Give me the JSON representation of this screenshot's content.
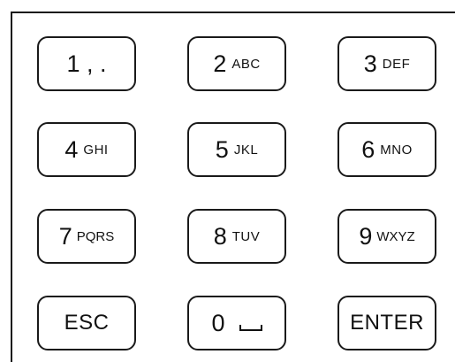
{
  "keypad": {
    "keys": [
      {
        "digit": "1 , .",
        "letters": ""
      },
      {
        "digit": "2",
        "letters": "ABC"
      },
      {
        "digit": "3",
        "letters": "DEF"
      },
      {
        "digit": "4",
        "letters": "GHI"
      },
      {
        "digit": "5",
        "letters": "JKL"
      },
      {
        "digit": "6",
        "letters": "MNO"
      },
      {
        "digit": "7",
        "letters": "PQRS"
      },
      {
        "digit": "8",
        "letters": "TUV"
      },
      {
        "digit": "9",
        "letters": "WXYZ"
      }
    ],
    "esc_label": "ESC",
    "zero_digit": "0",
    "enter_label": "ENTER"
  }
}
